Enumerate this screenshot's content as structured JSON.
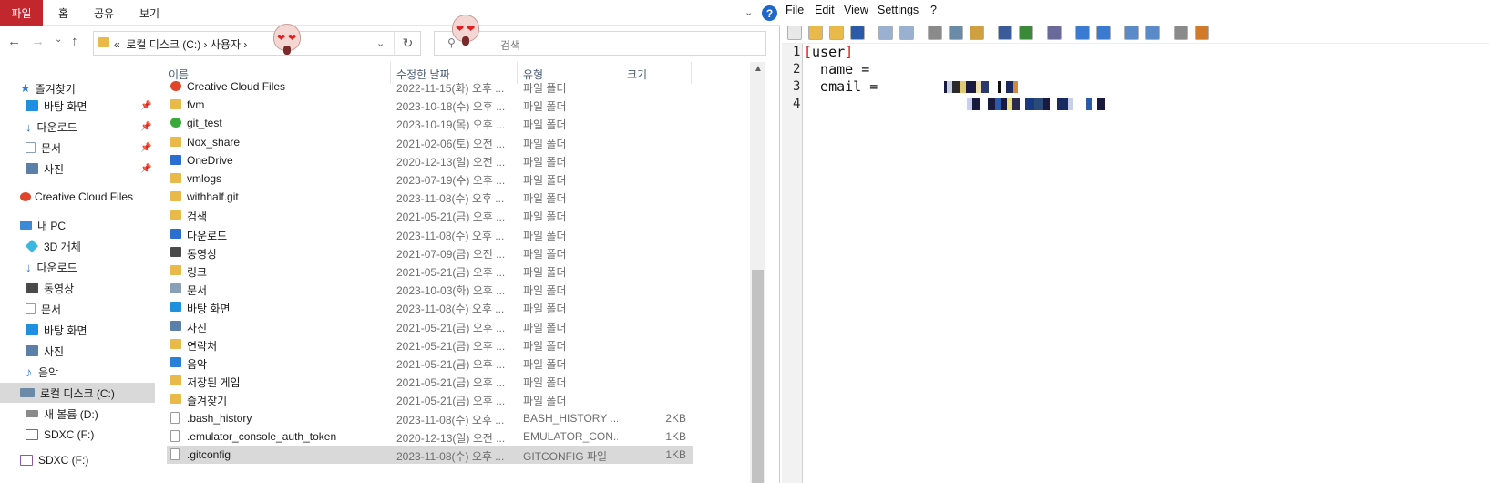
{
  "ribbon": {
    "file_tab": "파일",
    "tabs": [
      "홈",
      "공유",
      "보기"
    ],
    "help": "?"
  },
  "address": {
    "prefix": "«",
    "crumbs": "로컬 디스크 (C:)  ›  사용자  ›",
    "search_placeholder": "검색"
  },
  "sidebar": {
    "items": [
      {
        "label": "즐겨찾기",
        "icon": "star-icon",
        "color": "#2f7fd8"
      },
      {
        "label": "바탕 화면",
        "icon": "desktop-icon",
        "color": "#1f8fe0",
        "pinned": true
      },
      {
        "label": "다운로드",
        "icon": "download-icon",
        "color": "#2a6fd0",
        "pinned": true
      },
      {
        "label": "문서",
        "icon": "document-icon",
        "color": "#8aa0b8",
        "pinned": true
      },
      {
        "label": "사진",
        "icon": "pictures-icon",
        "color": "#5a7fa8",
        "pinned": true
      },
      {
        "label": "Creative Cloud Files",
        "icon": "creative-cloud-icon",
        "color": "#e0452a"
      },
      {
        "label": "내 PC",
        "icon": "pc-icon",
        "color": "#3a8ad8"
      },
      {
        "label": "3D 개체",
        "icon": "3d-objects-icon",
        "color": "#3ab8e0"
      },
      {
        "label": "다운로드",
        "icon": "download-icon",
        "color": "#2a6fd0"
      },
      {
        "label": "동영상",
        "icon": "video-icon",
        "color": "#4a4a4a"
      },
      {
        "label": "문서",
        "icon": "document-icon",
        "color": "#8aa0b8"
      },
      {
        "label": "바탕 화면",
        "icon": "desktop-icon",
        "color": "#1f8fe0"
      },
      {
        "label": "사진",
        "icon": "pictures-icon",
        "color": "#5a7fa8"
      },
      {
        "label": "음악",
        "icon": "music-icon",
        "color": "#2a7fd8"
      },
      {
        "label": "로컬 디스크 (C:)",
        "icon": "drive-icon",
        "color": "#6a8aa8",
        "selected": true
      },
      {
        "label": "새 볼륨 (D:)",
        "icon": "drive-icon",
        "color": "#8a8a8a"
      },
      {
        "label": "SDXC (F:)",
        "icon": "sd-card-icon",
        "color": "#8a5aa8"
      },
      {
        "label": "SDXC (F:)",
        "icon": "sd-card-icon",
        "color": "#8a5aa8"
      }
    ]
  },
  "columns": {
    "name": "이름",
    "date": "수정한 날짜",
    "type": "유형",
    "size": "크기"
  },
  "files": [
    {
      "name": "Creative Cloud Files",
      "date": "2022-11-15(화) 오후 ...",
      "type": "파일 폴더",
      "size": "",
      "icon": "creative-cloud-icon",
      "color": "#e0452a"
    },
    {
      "name": "fvm",
      "date": "2023-10-18(수) 오후 ...",
      "type": "파일 폴더",
      "size": "",
      "icon": "folder-icon",
      "color": "#e9b94a"
    },
    {
      "name": "git_test",
      "date": "2023-10-19(목) 오후 ...",
      "type": "파일 폴더",
      "size": "",
      "icon": "git-icon",
      "color": "#3aa83a"
    },
    {
      "name": "Nox_share",
      "date": "2021-02-06(토) 오전 ...",
      "type": "파일 폴더",
      "size": "",
      "icon": "folder-icon",
      "color": "#e9b94a"
    },
    {
      "name": "OneDrive",
      "date": "2020-12-13(일) 오전 ...",
      "type": "파일 폴더",
      "size": "",
      "icon": "onedrive-icon",
      "color": "#2a6fd0"
    },
    {
      "name": "vmlogs",
      "date": "2023-07-19(수) 오후 ...",
      "type": "파일 폴더",
      "size": "",
      "icon": "folder-icon",
      "color": "#e9b94a"
    },
    {
      "name": "withhalf.git",
      "date": "2023-11-08(수) 오후 ...",
      "type": "파일 폴더",
      "size": "",
      "icon": "folder-icon",
      "color": "#e9b94a"
    },
    {
      "name": "검색",
      "date": "2021-05-21(금) 오후 ...",
      "type": "파일 폴더",
      "size": "",
      "icon": "search-folder-icon",
      "color": "#e9b94a"
    },
    {
      "name": "다운로드",
      "date": "2023-11-08(수) 오후 ...",
      "type": "파일 폴더",
      "size": "",
      "icon": "download-icon",
      "color": "#2a6fd0"
    },
    {
      "name": "동영상",
      "date": "2021-07-09(금) 오전 ...",
      "type": "파일 폴더",
      "size": "",
      "icon": "video-icon",
      "color": "#4a4a4a"
    },
    {
      "name": "링크",
      "date": "2021-05-21(금) 오후 ...",
      "type": "파일 폴더",
      "size": "",
      "icon": "links-icon",
      "color": "#e9b94a"
    },
    {
      "name": "문서",
      "date": "2023-10-03(화) 오후 ...",
      "type": "파일 폴더",
      "size": "",
      "icon": "document-icon",
      "color": "#8aa0b8"
    },
    {
      "name": "바탕 화면",
      "date": "2023-11-08(수) 오후 ...",
      "type": "파일 폴더",
      "size": "",
      "icon": "desktop-icon",
      "color": "#1f8fe0"
    },
    {
      "name": "사진",
      "date": "2021-05-21(금) 오후 ...",
      "type": "파일 폴더",
      "size": "",
      "icon": "pictures-icon",
      "color": "#5a7fa8"
    },
    {
      "name": "연락처",
      "date": "2021-05-21(금) 오후 ...",
      "type": "파일 폴더",
      "size": "",
      "icon": "contacts-icon",
      "color": "#e9b94a"
    },
    {
      "name": "음악",
      "date": "2021-05-21(금) 오후 ...",
      "type": "파일 폴더",
      "size": "",
      "icon": "music-icon",
      "color": "#2a7fd8"
    },
    {
      "name": "저장된 게임",
      "date": "2021-05-21(금) 오후 ...",
      "type": "파일 폴더",
      "size": "",
      "icon": "saved-games-icon",
      "color": "#e9b94a"
    },
    {
      "name": "즐겨찾기",
      "date": "2021-05-21(금) 오후 ...",
      "type": "파일 폴더",
      "size": "",
      "icon": "favorites-icon",
      "color": "#e9b94a"
    },
    {
      "name": ".bash_history",
      "date": "2023-11-08(수) 오후 ...",
      "type": "BASH_HISTORY ...",
      "size": "2KB",
      "icon": "file-icon",
      "color": "#ffffff"
    },
    {
      "name": ".emulator_console_auth_token",
      "date": "2020-12-13(일) 오전 ...",
      "type": "EMULATOR_CON...",
      "size": "1KB",
      "icon": "file-icon",
      "color": "#ffffff"
    },
    {
      "name": ".gitconfig",
      "date": "2023-11-08(수) 오후 ...",
      "type": "GITCONFIG 파일",
      "size": "1KB",
      "icon": "file-icon",
      "color": "#ffffff",
      "selected": true
    }
  ],
  "editor": {
    "menus": [
      "File",
      "Edit",
      "View",
      "Settings",
      "?"
    ],
    "toolbar_icons": [
      "new-icon",
      "open-icon",
      "open-folder-icon",
      "save-icon",
      "undo-icon",
      "redo-icon",
      "cut-icon",
      "copy-icon",
      "paste-icon",
      "find-icon",
      "replace-icon",
      "print-preview-icon",
      "zoom-in-icon",
      "zoom-out-icon",
      "window-icon",
      "edit-icon",
      "run-icon",
      "macro-icon"
    ],
    "line_numbers": [
      "1",
      "2",
      "3",
      "4"
    ],
    "lines": {
      "l1_open": "[",
      "l1_text": "user",
      "l1_close": "]",
      "l2_key": "  name = ",
      "l3_key": "  email = "
    }
  }
}
